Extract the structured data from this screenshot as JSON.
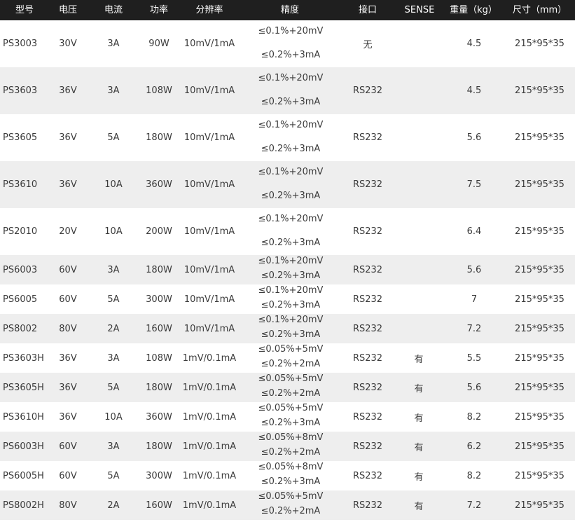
{
  "headers": [
    "型号",
    "电压",
    "电流",
    "功率",
    "分辨率",
    "精度",
    "接口",
    "SENSE",
    "重量（kg）",
    "尺寸（mm）"
  ],
  "rows": [
    [
      "PS3003",
      "30V",
      "3A",
      "90W",
      "10mV/1mA",
      "≤0.1%+20mV",
      "≤0.2%+3mA",
      "无",
      "",
      "4.5",
      "215*95*35"
    ],
    [
      "PS3603",
      "36V",
      "3A",
      "108W",
      "10mV/1mA",
      "≤0.1%+20mV",
      "≤0.2%+3mA",
      "RS232",
      "",
      "4.5",
      "215*95*35"
    ],
    [
      "PS3605",
      "36V",
      "5A",
      "180W",
      "10mV/1mA",
      "≤0.1%+20mV",
      "≤0.2%+3mA",
      "RS232",
      "",
      "5.6",
      "215*95*35"
    ],
    [
      "PS3610",
      "36V",
      "10A",
      "360W",
      "10mV/1mA",
      "≤0.1%+20mV",
      "≤0.2%+3mA",
      "RS232",
      "",
      "7.5",
      "215*95*35"
    ],
    [
      "PS2010",
      "20V",
      "10A",
      "200W",
      "10mV/1mA",
      "≤0.1%+20mV",
      "≤0.2%+3mA",
      "RS232",
      "",
      "6.4",
      "215*95*35"
    ],
    [
      "PS6003",
      "60V",
      "3A",
      "180W",
      "10mV/1mA",
      "≤0.1%+20mV",
      "≤0.2%+3mA",
      "RS232",
      "",
      "5.6",
      "215*95*35"
    ],
    [
      "PS6005",
      "60V",
      "5A",
      "300W",
      "10mV/1mA",
      "≤0.1%+20mV",
      "≤0.2%+3mA",
      "RS232",
      "",
      "7",
      "215*95*35"
    ],
    [
      "PS8002",
      "80V",
      "2A",
      "160W",
      "10mV/1mA",
      "≤0.1%+20mV",
      "≤0.2%+3mA",
      "RS232",
      "",
      "7.2",
      "215*95*35"
    ],
    [
      "PS3603H",
      "36V",
      "3A",
      "108W",
      "1mV/0.1mA",
      "≤0.05%+5mV",
      "≤0.2%+2mA",
      "RS232",
      "有",
      "5.5",
      "215*95*35"
    ],
    [
      "PS3605H",
      "36V",
      "5A",
      "180W",
      "1mV/0.1mA",
      "≤0.05%+5mV",
      "≤0.2%+2mA",
      "RS232",
      "有",
      "5.6",
      "215*95*35"
    ],
    [
      "PS3610H",
      "36V",
      "10A",
      "360W",
      "1mV/0.1mA",
      "≤0.05%+5mV",
      "≤0.2%+3mA",
      "RS232",
      "有",
      "8.2",
      "215*95*35"
    ],
    [
      "PS6003H",
      "60V",
      "3A",
      "180W",
      "1mV/0.1mA",
      "≤0.05%+8mV",
      "≤0.2%+2mA",
      "RS232",
      "有",
      "6.2",
      "215*95*35"
    ],
    [
      "PS6005H",
      "60V",
      "5A",
      "300W",
      "1mV/0.1mA",
      "≤0.05%+8mV",
      "≤0.2%+3mA",
      "RS232",
      "有",
      "8.2",
      "215*95*35"
    ],
    [
      "PS8002H",
      "80V",
      "2A",
      "160W",
      "1mV/0.1mA",
      "≤0.05%+5mV",
      "≤0.2%+2mA",
      "RS232",
      "有",
      "7.2",
      "215*95*35"
    ]
  ]
}
